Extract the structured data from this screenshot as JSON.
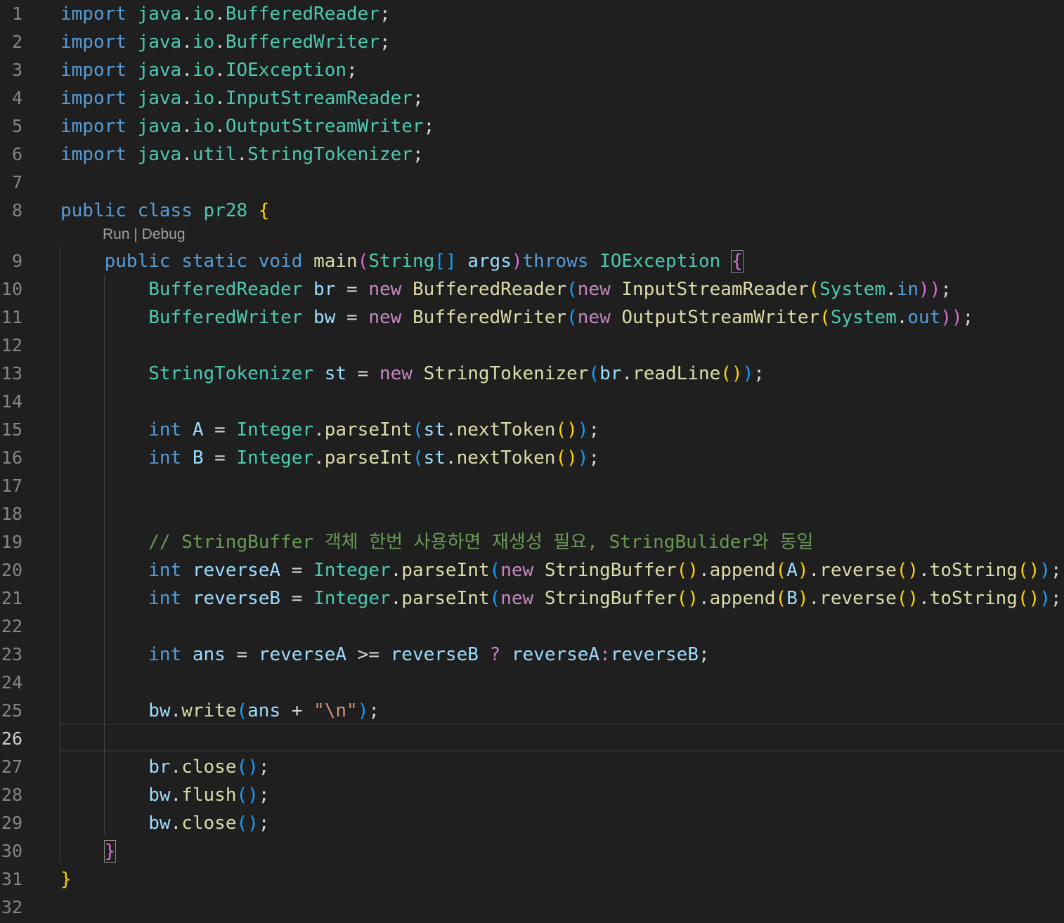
{
  "editor": {
    "line_numbers": [
      "1",
      "2",
      "3",
      "4",
      "5",
      "6",
      "7",
      "8",
      "9",
      "10",
      "11",
      "12",
      "13",
      "14",
      "15",
      "16",
      "17",
      "18",
      "19",
      "20",
      "21",
      "22",
      "23",
      "24",
      "25",
      "26",
      "27",
      "28",
      "29",
      "30",
      "31",
      "32"
    ],
    "active_line": "26",
    "codelens": {
      "run": "Run",
      "sep": " | ",
      "debug": "Debug"
    }
  },
  "code": {
    "l1": [
      "import",
      " ",
      "java",
      ".",
      "io",
      ".",
      "BufferedReader",
      ";"
    ],
    "l2": [
      "import",
      " ",
      "java",
      ".",
      "io",
      ".",
      "BufferedWriter",
      ";"
    ],
    "l3": [
      "import",
      " ",
      "java",
      ".",
      "io",
      ".",
      "IOException",
      ";"
    ],
    "l4": [
      "import",
      " ",
      "java",
      ".",
      "io",
      ".",
      "InputStreamReader",
      ";"
    ],
    "l5": [
      "import",
      " ",
      "java",
      ".",
      "io",
      ".",
      "OutputStreamWriter",
      ";"
    ],
    "l6": [
      "import",
      " ",
      "java",
      ".",
      "util",
      ".",
      "StringTokenizer",
      ";"
    ],
    "l8": [
      "public",
      " ",
      "class",
      " ",
      "pr28",
      " ",
      "{"
    ],
    "l9": [
      "    ",
      "public",
      " ",
      "static",
      " ",
      "void",
      " ",
      "main",
      "(",
      "String",
      "[]",
      " ",
      "args",
      ")",
      "throws",
      " ",
      "IOException",
      " ",
      "{"
    ],
    "l10": [
      "        ",
      "BufferedReader",
      " ",
      "br",
      " = ",
      "new",
      " ",
      "BufferedReader",
      "(",
      "new",
      " ",
      "InputStreamReader",
      "(",
      "System",
      ".",
      "in",
      "))",
      ";"
    ],
    "l11": [
      "        ",
      "BufferedWriter",
      " ",
      "bw",
      " = ",
      "new",
      " ",
      "BufferedWriter",
      "(",
      "new",
      " ",
      "OutputStreamWriter",
      "(",
      "System",
      ".",
      "out",
      "))",
      ";"
    ],
    "l13": [
      "        ",
      "StringTokenizer",
      " ",
      "st",
      " = ",
      "new",
      " ",
      "StringTokenizer",
      "(",
      "br",
      ".",
      "readLine",
      "()",
      ")",
      ";"
    ],
    "l15": [
      "        ",
      "int",
      " ",
      "A",
      " = ",
      "Integer",
      ".",
      "parseInt",
      "(",
      "st",
      ".",
      "nextToken",
      "()",
      ")",
      ";"
    ],
    "l16": [
      "        ",
      "int",
      " ",
      "B",
      " = ",
      "Integer",
      ".",
      "parseInt",
      "(",
      "st",
      ".",
      "nextToken",
      "()",
      ")",
      ";"
    ],
    "l19": [
      "        ",
      "// StringBuffer 객체 한번 사용하면 재생성 필요, StringBulider와 동일"
    ],
    "l20": [
      "        ",
      "int",
      " ",
      "reverseA",
      " = ",
      "Integer",
      ".",
      "parseInt",
      "(",
      "new",
      " ",
      "StringBuffer",
      "()",
      ".",
      "append",
      "(",
      "A",
      ")",
      ".",
      "reverse",
      "()",
      ".",
      "toString",
      "()",
      ")",
      ";"
    ],
    "l21": [
      "        ",
      "int",
      " ",
      "reverseB",
      " = ",
      "Integer",
      ".",
      "parseInt",
      "(",
      "new",
      " ",
      "StringBuffer",
      "()",
      ".",
      "append",
      "(",
      "B",
      ")",
      ".",
      "reverse",
      "()",
      ".",
      "toString",
      "()",
      ")",
      ";"
    ],
    "l23": [
      "        ",
      "int",
      " ",
      "ans",
      " = ",
      "reverseA",
      " >= ",
      "reverseB",
      " ",
      "?",
      " ",
      "reverseA",
      ":",
      "reverseB",
      ";"
    ],
    "l25": [
      "        ",
      "bw",
      ".",
      "write",
      "(",
      "ans",
      " + ",
      "\"\\n\"",
      ")",
      ";"
    ],
    "l27": [
      "        ",
      "br",
      ".",
      "close",
      "()",
      ";"
    ],
    "l28": [
      "        ",
      "bw",
      ".",
      "flush",
      "()",
      ";"
    ],
    "l29": [
      "        ",
      "bw",
      ".",
      "close",
      "()",
      ";"
    ],
    "l30": [
      "    ",
      "}"
    ],
    "l31": [
      "}"
    ]
  },
  "theme": {
    "background": "#1f1f1f",
    "keyword": "#569cd6",
    "control_keyword": "#c586c0",
    "type": "#4ec9b0",
    "variable": "#9cdcfe",
    "function": "#dcdcaa",
    "string": "#ce9178",
    "comment": "#6a9955",
    "bracket_level1": "#ffd700",
    "bracket_level2": "#da70d6",
    "bracket_level3": "#179fff"
  }
}
